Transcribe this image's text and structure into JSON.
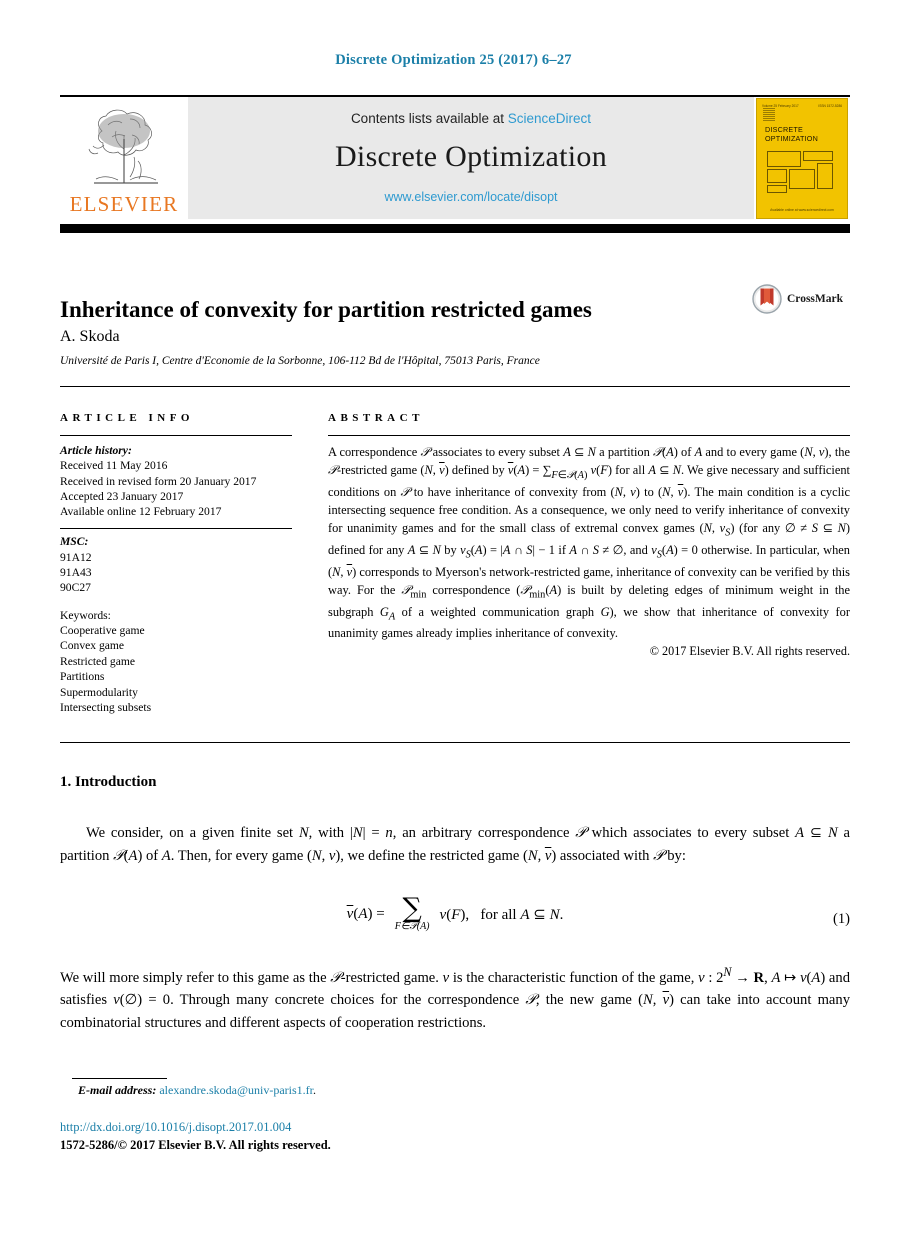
{
  "running_head": "Discrete Optimization 25 (2017) 6–27",
  "banner": {
    "publisher_name": "ELSEVIER",
    "contents_prefix": "Contents lists available at ",
    "sciencedirect": "ScienceDirect",
    "journal_name": "Discrete Optimization",
    "journal_url": "www.elsevier.com/locate/disopt",
    "cover": {
      "volume_line": "Volume 25   February 2017",
      "issn_line": "ISSN 1572-5286",
      "title_line1": "DISCRETE",
      "title_line2": "OPTIMIZATION",
      "footer": "Available online at www.sciencedirect.com"
    }
  },
  "title": "Inheritance of convexity for partition restricted games",
  "crossmark_label": "CrossMark",
  "author": "A. Skoda",
  "affiliation": "Université de Paris I, Centre d'Economie de la Sorbonne, 106-112 Bd de l'Hôpital, 75013 Paris, France",
  "article_info": {
    "heading": "ARTICLE INFO",
    "history_label": "Article history:",
    "history": [
      "Received 11 May 2016",
      "Received in revised form 20 January 2017",
      "Accepted 23 January 2017",
      "Available online 12 February 2017"
    ],
    "msc_label": "MSC:",
    "msc": [
      "91A12",
      "91A43",
      "90C27"
    ],
    "keywords_label": "Keywords:",
    "keywords": [
      "Cooperative game",
      "Convex game",
      "Restricted game",
      "Partitions",
      "Supermodularity",
      "Intersecting subsets"
    ]
  },
  "abstract": {
    "heading": "ABSTRACT",
    "text": "A correspondence 𝒫 associates to every subset A ⊆ N a partition 𝒫(A) of A and to every game (N, v), the 𝒫-restricted game (N, v̅) defined by v̅(A) = ∑F∈𝒫(A) v(F) for all A ⊆ N. We give necessary and sufficient conditions on 𝒫 to have inheritance of convexity from (N, v) to (N, v̅). The main condition is a cyclic intersecting sequence free condition. As a consequence, we only need to verify inheritance of convexity for unanimity games and for the small class of extremal convex games (N, v_S) (for any ∅ ≠ S ⊆ N) defined for any A ⊆ N by v_S(A) = |A ∩ S| − 1 if A ∩ S ≠ ∅, and v_S(A) = 0 otherwise. In particular, when (N, v̅) corresponds to Myerson's network-restricted game, inheritance of convexity can be verified by this way. For the 𝒫min correspondence (𝒫min(A) is built by deleting edges of minimum weight in the subgraph G_A of a weighted communication graph G), we show that inheritance of convexity for unanimity games already implies inheritance of convexity.",
    "copyright": "© 2017 Elsevier B.V. All rights reserved."
  },
  "introduction": {
    "heading": "1.  Introduction",
    "paragraph1": "We consider, on a given finite set N, with |N| = n, an arbitrary correspondence 𝒫 which associates to every subset A ⊆ N a partition 𝒫(A) of A. Then, for every game (N, v), we define the restricted game (N, v̅) associated with 𝒫 by:",
    "equation": {
      "lhs": "v̅(A) =",
      "sum_subscript": "F∈𝒫(A)",
      "rhs": "v(F),    for all A ⊆ N.",
      "number": "(1)"
    },
    "paragraph2": "We will more simply refer to this game as the 𝒫-restricted game. v is the characteristic function of the game, v : 2^N → ℝ, A ↦ v(A) and satisfies v(∅) = 0. Through many concrete choices for the correspondence 𝒫, the new game (N, v̅) can take into account many combinatorial structures and different aspects of cooperation restrictions."
  },
  "footer": {
    "email_label": "E-mail address:",
    "email": "alexandre.skoda@univ-paris1.fr",
    "doi": "http://dx.doi.org/10.1016/j.disopt.2017.01.004",
    "issn_copyright": "1572-5286/© 2017 Elsevier B.V. All rights reserved."
  },
  "colors": {
    "link": "#1b7fa8",
    "sciencedirect": "#2e9ad0",
    "elsevier_orange": "#E87722",
    "cover_yellow": "#F2C300"
  }
}
